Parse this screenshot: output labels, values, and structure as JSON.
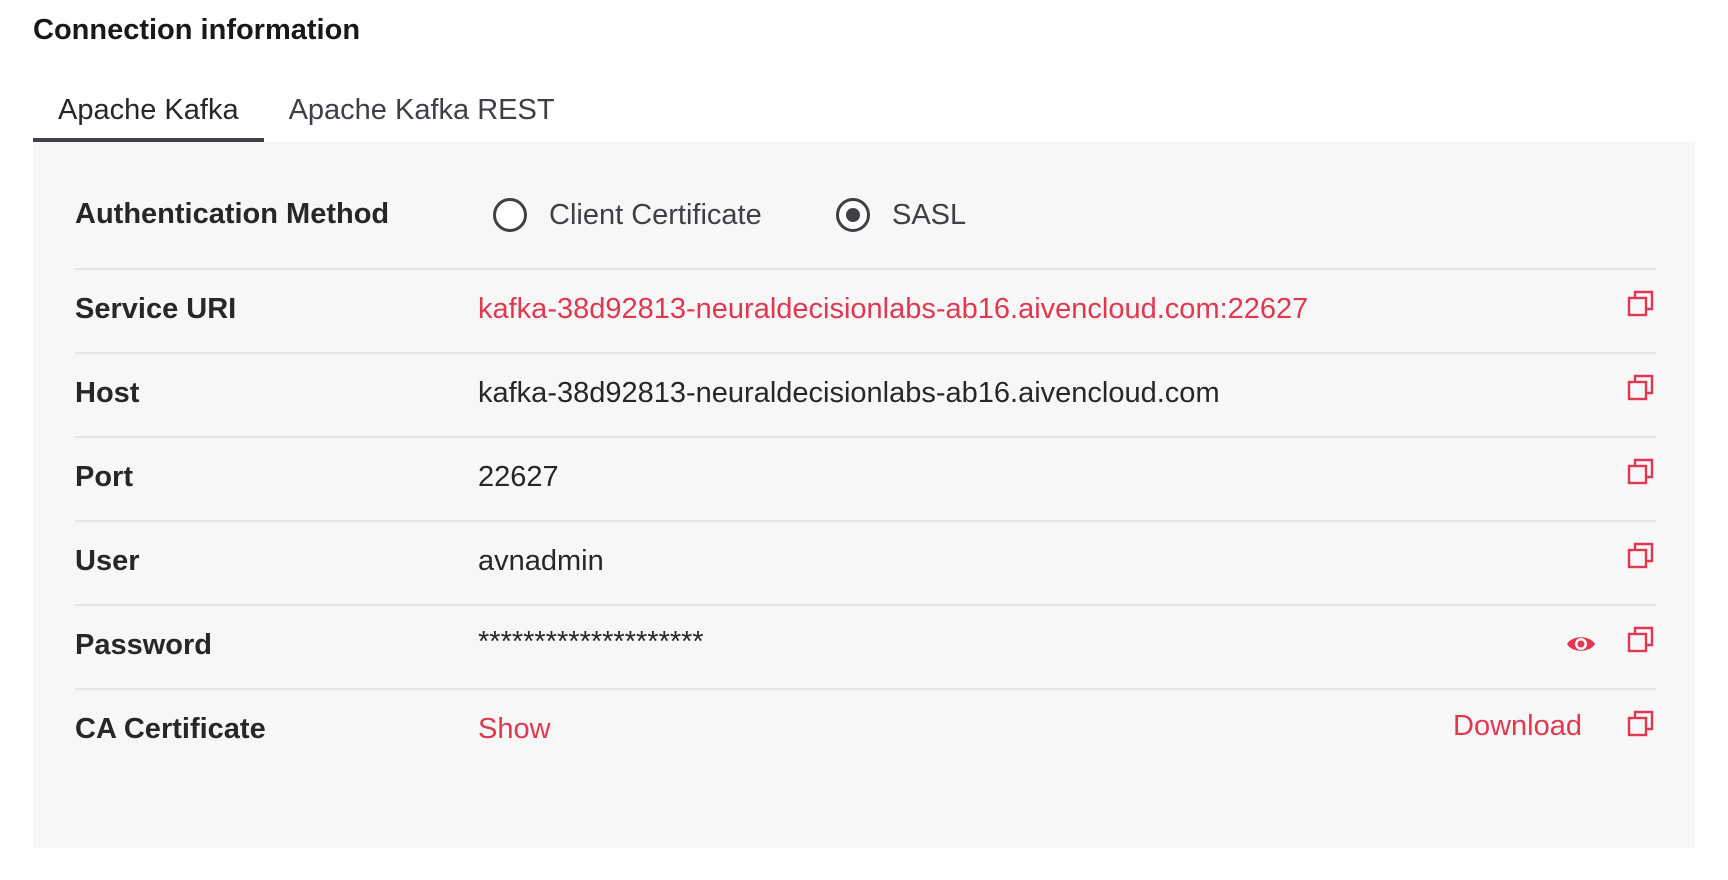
{
  "section": {
    "title": "Connection information"
  },
  "tabs": [
    {
      "label": "Apache Kafka",
      "active": true
    },
    {
      "label": "Apache Kafka REST",
      "active": false
    }
  ],
  "auth": {
    "label": "Authentication Method",
    "options": [
      {
        "label": "Client Certificate",
        "checked": false
      },
      {
        "label": "SASL",
        "checked": true
      }
    ]
  },
  "fields": {
    "service_uri": {
      "label": "Service URI",
      "value": "kafka-38d92813-neuraldecisionlabs-ab16.aivencloud.com:22627"
    },
    "host": {
      "label": "Host",
      "value": "kafka-38d92813-neuraldecisionlabs-ab16.aivencloud.com"
    },
    "port": {
      "label": "Port",
      "value": "22627"
    },
    "user": {
      "label": "User",
      "value": "avnadmin"
    },
    "password": {
      "label": "Password",
      "value": "********************"
    },
    "ca_certificate": {
      "label": "CA Certificate",
      "show_label": "Show",
      "download_label": "Download"
    }
  },
  "icons": {
    "copy": "copy-icon",
    "eye": "eye-icon"
  },
  "colors": {
    "accent": "#e1384f",
    "text": "#27272a",
    "panel_bg": "#f7f7f8",
    "divider": "#e4e4e7"
  }
}
